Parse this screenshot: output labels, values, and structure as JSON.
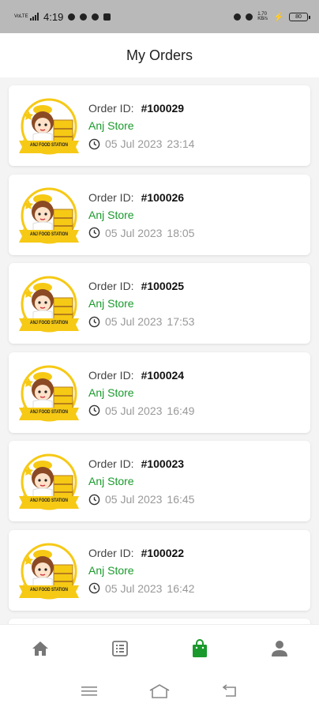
{
  "status_bar": {
    "network_text": "VoLTE",
    "time": "4:19",
    "speed_text": "1.70 KB/s",
    "battery_level": "80"
  },
  "header": {
    "title": "My Orders"
  },
  "orders": [
    {
      "order_id_label": "Order ID:",
      "order_id": "#100029",
      "store": "Anj Store",
      "date": "05 Jul 2023",
      "time": "23:14",
      "logo_text": "ANJ FOOD STATION"
    },
    {
      "order_id_label": "Order ID:",
      "order_id": "#100026",
      "store": "Anj Store",
      "date": "05 Jul 2023",
      "time": "18:05",
      "logo_text": "ANJ FOOD STATION"
    },
    {
      "order_id_label": "Order ID:",
      "order_id": "#100025",
      "store": "Anj Store",
      "date": "05 Jul 2023",
      "time": "17:53",
      "logo_text": "ANJ FOOD STATION"
    },
    {
      "order_id_label": "Order ID:",
      "order_id": "#100024",
      "store": "Anj Store",
      "date": "05 Jul 2023",
      "time": "16:49",
      "logo_text": "ANJ FOOD STATION"
    },
    {
      "order_id_label": "Order ID:",
      "order_id": "#100023",
      "store": "Anj Store",
      "date": "05 Jul 2023",
      "time": "16:45",
      "logo_text": "ANJ FOOD STATION"
    },
    {
      "order_id_label": "Order ID:",
      "order_id": "#100022",
      "store": "Anj Store",
      "date": "05 Jul 2023",
      "time": "16:42",
      "logo_text": "ANJ FOOD STATION"
    }
  ],
  "bottom_nav": {
    "items": [
      {
        "icon": "home-icon",
        "active": false
      },
      {
        "icon": "list-icon",
        "active": false
      },
      {
        "icon": "shopping-bag-icon",
        "active": true
      },
      {
        "icon": "profile-icon",
        "active": false
      }
    ]
  },
  "colors": {
    "accent": "#1a9a2c",
    "inactive_icon": "#777777",
    "logo_yellow": "#f6c915"
  }
}
